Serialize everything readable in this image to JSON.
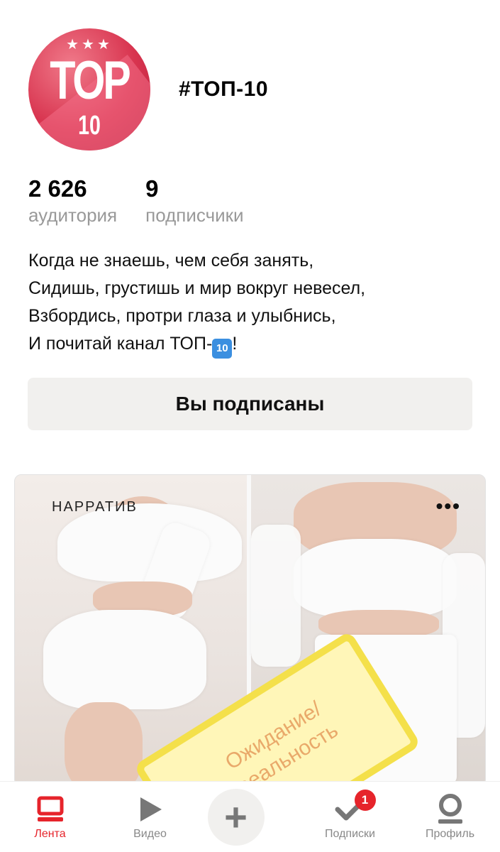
{
  "channel": {
    "avatar": {
      "stars": "★★★",
      "word": "TOP",
      "number": "10"
    },
    "title": "#ТОП-10"
  },
  "stats": [
    {
      "value": "2 626",
      "label": "аудитория"
    },
    {
      "value": "9",
      "label": "подписчики"
    }
  ],
  "description": {
    "lines": [
      "Когда не знаешь, чем себя занять,",
      "Сидишь, грустишь и мир вокруг невесел,",
      "Взбордись, протри глаза и улыбнись,"
    ],
    "last_line_prefix": "И почитай канал ТОП-",
    "last_line_badge": "10",
    "last_line_suffix": "!"
  },
  "subscribe_button": {
    "label": "Вы подписаны"
  },
  "card": {
    "tag": "НАРРАТИВ",
    "more": "•••",
    "note_text": "Ожидание/ реальность"
  },
  "bottom_nav": {
    "items": [
      {
        "label": "Лента",
        "icon": "feed-icon",
        "active": true
      },
      {
        "label": "Видео",
        "icon": "play-icon"
      },
      {
        "label": "",
        "icon": "plus-icon"
      },
      {
        "label": "Подписки",
        "icon": "check-icon",
        "badge": "1"
      },
      {
        "label": "Профиль",
        "icon": "profile-icon"
      }
    ]
  },
  "colors": {
    "accent": "#e6242b",
    "button_bg": "#f1f0ee",
    "muted_text": "#999999",
    "badge_blue": "#3b8fe0"
  }
}
